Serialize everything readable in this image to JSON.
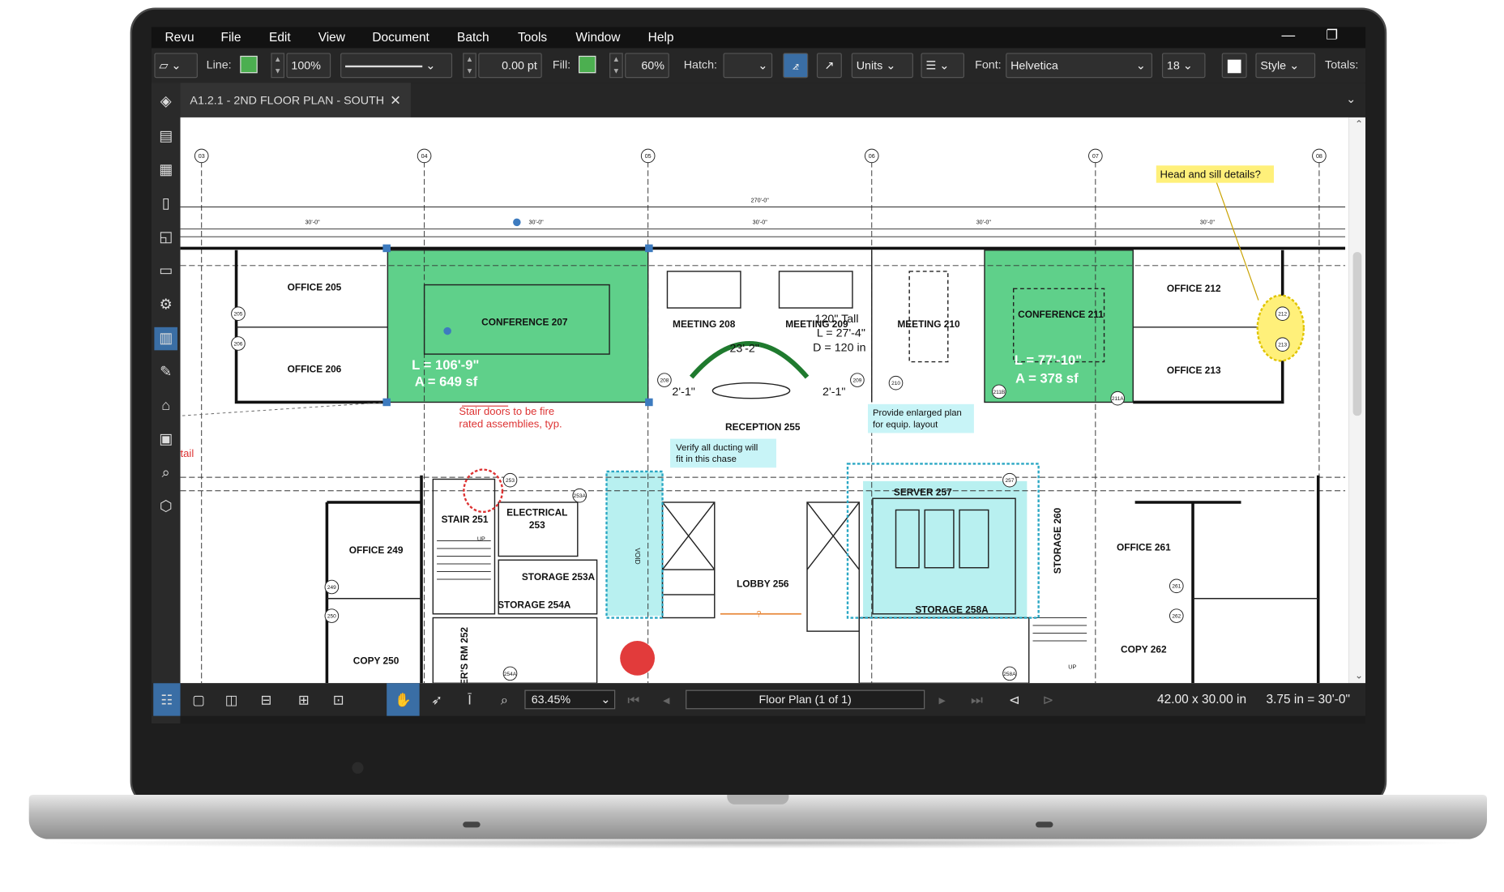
{
  "menu": {
    "items": [
      "Revu",
      "File",
      "Edit",
      "View",
      "Document",
      "Batch",
      "Tools",
      "Window",
      "Help"
    ]
  },
  "toolbar": {
    "line_label": "Line:",
    "line_color": "#4caf50",
    "opacity_value": "100%",
    "thickness_value": "0.00 pt",
    "fill_label": "Fill:",
    "fill_color": "#4caf50",
    "fill_opacity": "60%",
    "hatch_label": "Hatch:",
    "units_label": "Units",
    "font_label": "Font:",
    "font_value": "Helvetica",
    "font_size": "18",
    "style_label": "Style",
    "totals_label": "Totals:"
  },
  "tab": {
    "title": "A1.2.1 - 2ND FLOOR PLAN - SOUTH"
  },
  "status": {
    "zoom": "63.45%",
    "page": "Floor Plan (1 of 1)",
    "paper_size": "42.00 x 30.00 in",
    "scale": "3.75 in = 30'-0\""
  },
  "plan": {
    "grid_labels": [
      "03",
      "04",
      "05",
      "06",
      "07",
      "08"
    ],
    "overall_dim": "270'-0\"",
    "bay_dims": [
      "30'-0\"",
      "30'-0\"",
      "30'-0\"",
      "30'-0\"",
      "30'-0\""
    ],
    "rooms": {
      "office_205": "OFFICE  205",
      "office_206": "OFFICE  206",
      "conference_207": "CONFERENCE  207",
      "meeting_208": "MEETING  208",
      "meeting_209": "MEETING  209",
      "meeting_210": "MEETING  210",
      "conference_211": "CONFERENCE  211",
      "office_212": "OFFICE  212",
      "office_213": "OFFICE  213",
      "reception_255": "RECEPTION  255",
      "stair_251": "STAIR 251",
      "electrical_253a": "ELECTRICAL",
      "electrical_253b": "253",
      "storage_253a": "STORAGE 253A",
      "storage_254a": "STORAGE 254A",
      "lobby_256": "LOBBY  256",
      "server_257": "SERVER  257",
      "storage_258a": "STORAGE 258A",
      "storage_260": "STORAGE 260",
      "office_249": "OFFICE  249",
      "copy_250": "COPY  250",
      "office_261": "OFFICE  261",
      "copy_262": "COPY  262",
      "room_252": "ER'S RM 252",
      "void": "VOID"
    },
    "door_tags": [
      "205",
      "206",
      "208",
      "209",
      "210",
      "211B",
      "211A",
      "212",
      "213",
      "249",
      "250",
      "253",
      "253A",
      "257",
      "261",
      "262",
      "254A",
      "258A"
    ],
    "measure_207_length": "L = 106'-9\"",
    "measure_207_area": "A = 649 sf",
    "measure_211_length": "L = 77'-10\"",
    "measure_211_area": "A = 378 sf",
    "arc_length": "23'-2\"",
    "dim_left": "2'-1\"",
    "dim_right": "2'-1\"",
    "height_markup_1": "120\" Tall",
    "height_markup_2": "L = 27'-4\"",
    "height_markup_3": "D = 120 in",
    "lobby_dim": "?",
    "up_labels": [
      "UP",
      "UP"
    ],
    "left_edge_text": "tail"
  },
  "markups": {
    "head_sill": "Head and sill details?",
    "stair_note_1": "Stair doors to be fire",
    "stair_note_2": "rated assemblies, typ.",
    "ducting_1": "Verify all ducting will",
    "ducting_2": "fit in this chase",
    "enlarged_1": "Provide enlarged plan",
    "enlarged_2": "for equip. layout"
  }
}
